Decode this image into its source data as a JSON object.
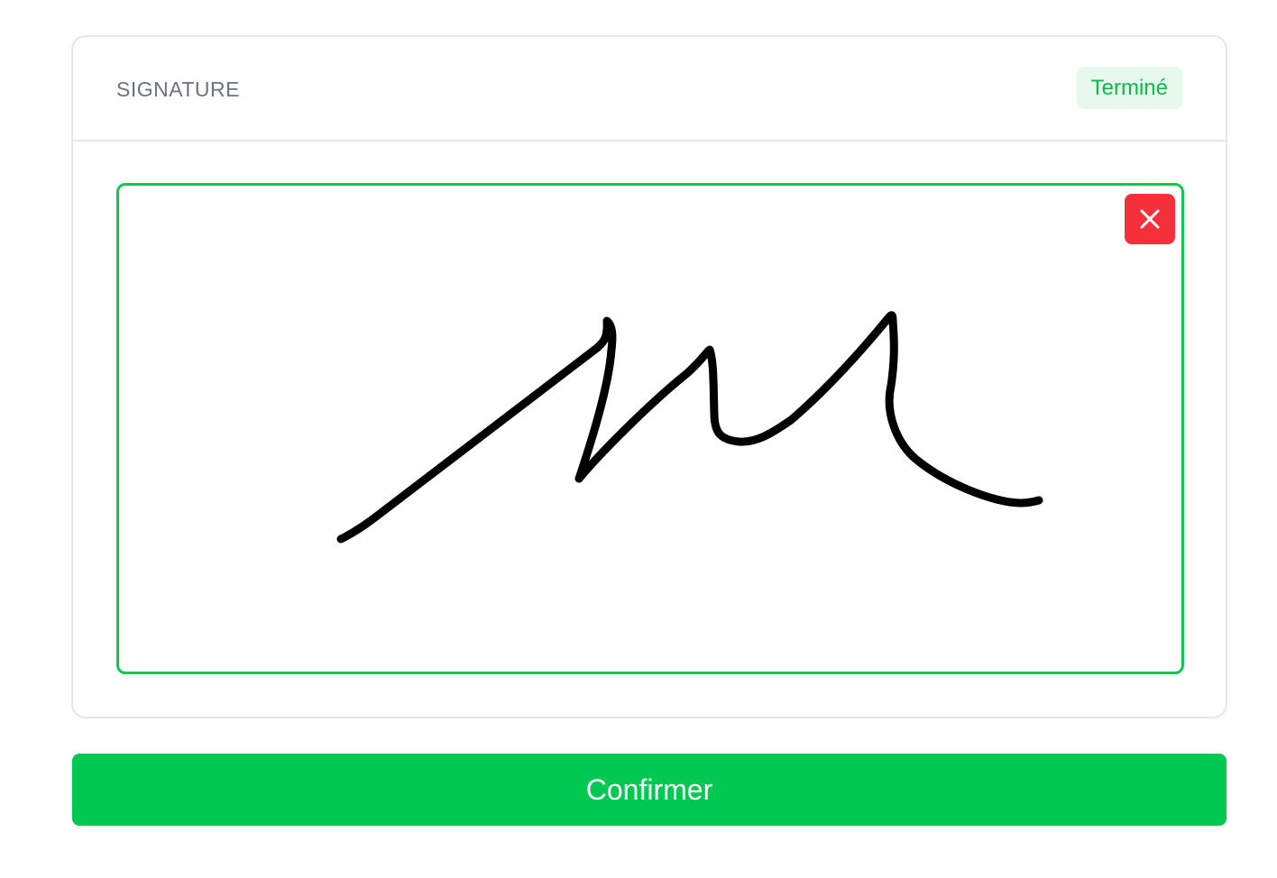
{
  "signature_card": {
    "title": "SIGNATURE",
    "status": "Terminé"
  },
  "signature_pad": {
    "clear_icon": "close-icon",
    "stroke_color": "#000000",
    "border_color": "#0ec850"
  },
  "actions": {
    "confirm_label": "Confirmer"
  },
  "colors": {
    "accent": "#00c850",
    "danger": "#f5303b",
    "badge_bg": "#e7f8ec",
    "badge_text": "#0fb84a"
  }
}
